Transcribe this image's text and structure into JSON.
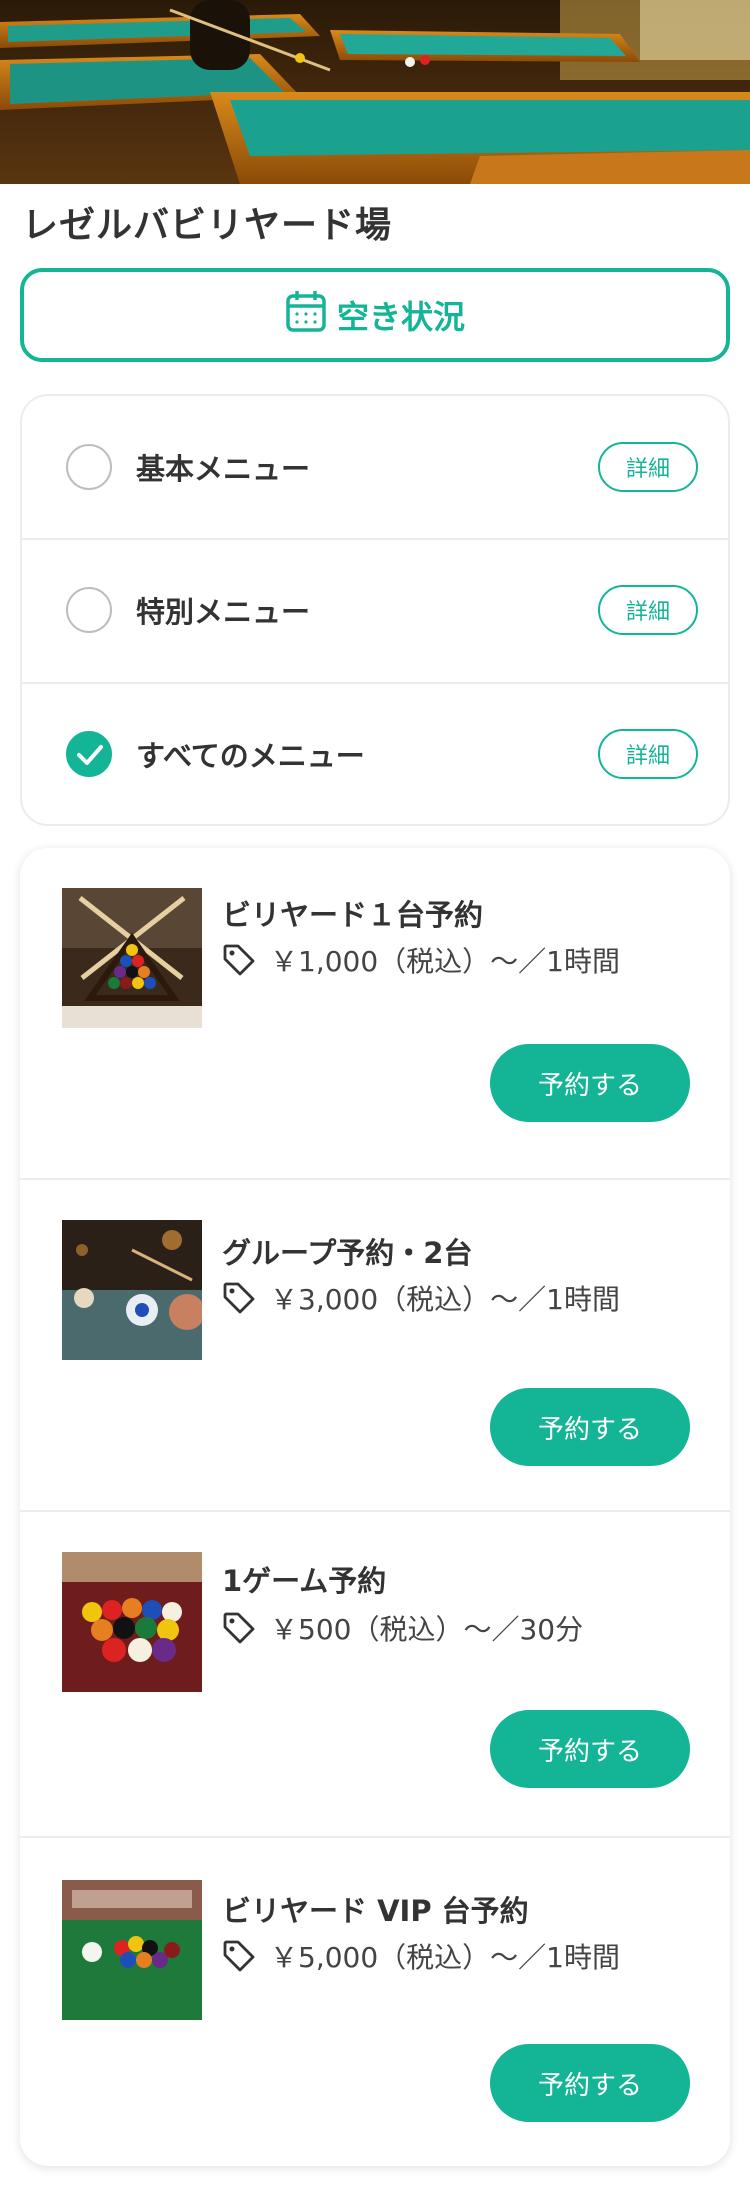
{
  "hero": {
    "image": "billiard-hall-photo"
  },
  "venue": {
    "title": "レゼルバビリヤード場"
  },
  "availability": {
    "label": "空き状況",
    "icon": "calendar-icon"
  },
  "menu_filter": {
    "options": [
      {
        "label": "基本メニュー",
        "checked": false,
        "detail_label": "詳細"
      },
      {
        "label": "特別メニュー",
        "checked": false,
        "detail_label": "詳細"
      },
      {
        "label": "すべてのメニュー",
        "checked": true,
        "detail_label": "詳細"
      }
    ]
  },
  "plans": [
    {
      "name": "ビリヤード１台予約",
      "price": "￥1,000（税込）〜／1時間",
      "button": "予約する",
      "image": "cues-and-rack-photo"
    },
    {
      "name": "グループ予約・2台",
      "price": "￥3,000（税込）〜／1時間",
      "button": "予約する",
      "image": "player-shot-photo"
    },
    {
      "name": "1ゲーム予約",
      "price": "￥500（税込）〜／30分",
      "button": "予約する",
      "image": "racked-balls-red-table-photo"
    },
    {
      "name": "ビリヤード VIP 台予約",
      "price": "￥5,000（税込）〜／1時間",
      "button": "予約する",
      "image": "balls-green-table-photo"
    }
  ],
  "colors": {
    "accent": "#14b597",
    "text": "#333333",
    "divider": "#ececec"
  }
}
